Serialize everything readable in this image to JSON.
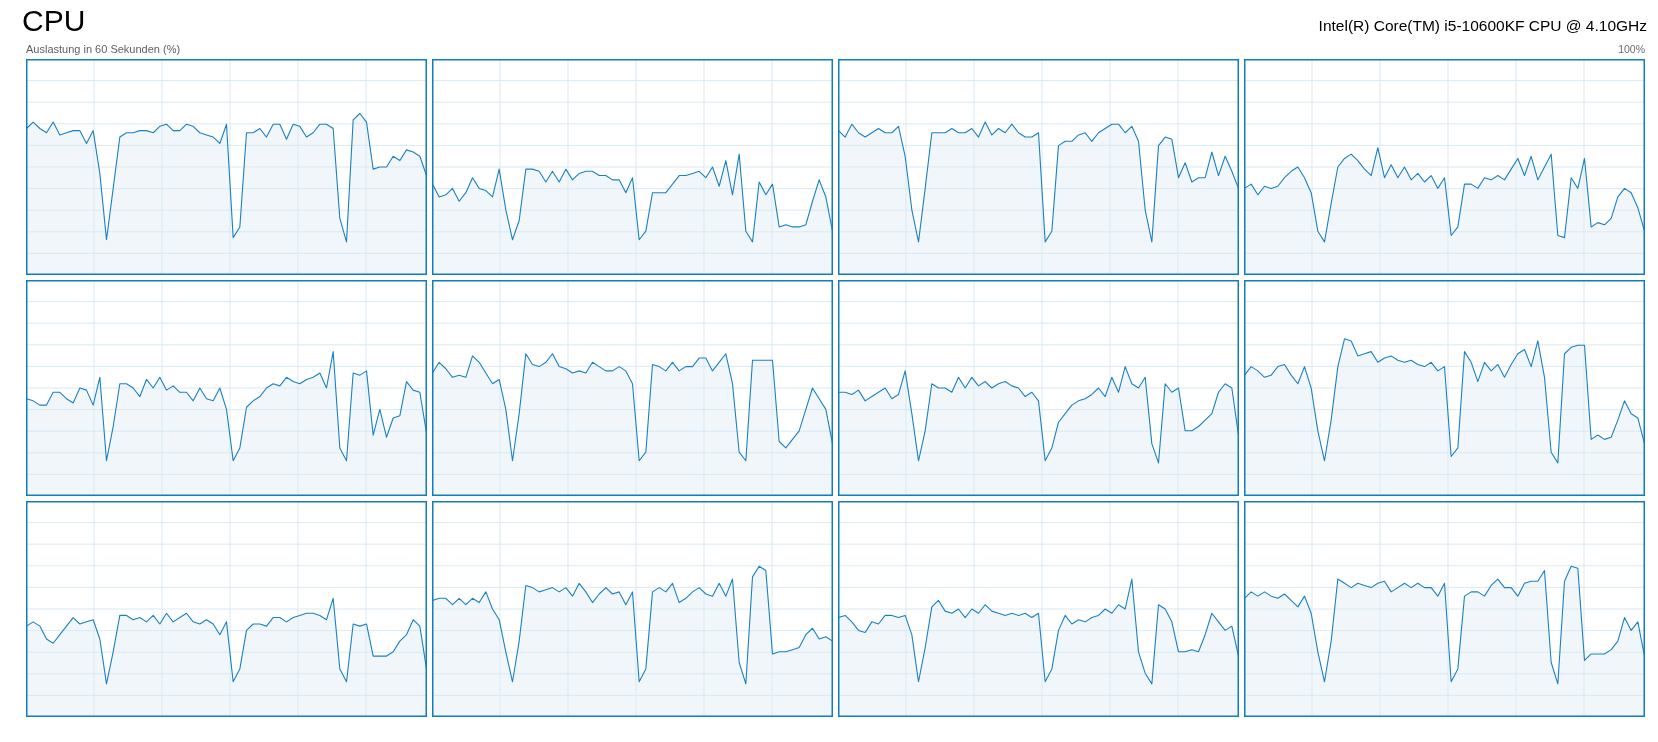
{
  "header": {
    "title": "CPU",
    "processor": "Intel(R) Core(TM) i5-10600KF CPU @ 4.10GHz"
  },
  "graphs": {
    "caption": "Auslastung in 60 Sekunden (%)",
    "max_label": "100%"
  }
}
